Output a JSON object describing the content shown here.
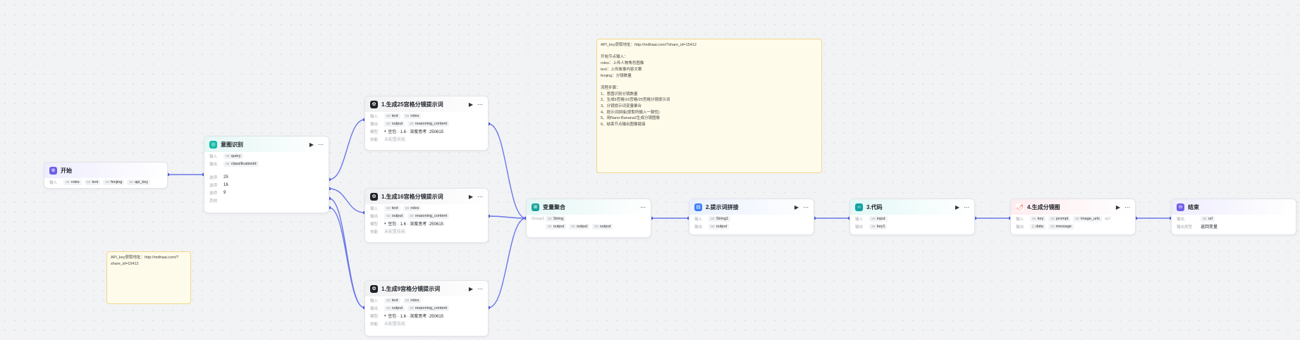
{
  "colors": {
    "wire": "#6b77e8",
    "start": "#6e5fe6",
    "intent": "#14b8a6",
    "llm": "#1f2329",
    "merge": "#14a39a",
    "prompt": "#3b7cf7",
    "code": "#12a3a3",
    "image": "#ff5a3c",
    "end": "#6e5fe6"
  },
  "labels": {
    "input": "输入",
    "output": "输出",
    "model": "模型",
    "skill": "技能",
    "option": "选项",
    "other": "其他",
    "group": "Group1",
    "output_type": "输出类型",
    "not_configured": "未配置技能"
  },
  "start": {
    "title": "开始",
    "icon": "start-icon",
    "inputs": [
      {
        "t": "Str",
        "name": "roles"
      },
      {
        "t": "Str",
        "name": "text"
      },
      {
        "t": "Str",
        "name": "fenjing"
      },
      {
        "t": "Str",
        "name": "api_key"
      }
    ]
  },
  "intent": {
    "title": "意图识别",
    "icon": "intent-icon",
    "input": {
      "t": "Str",
      "name": "query"
    },
    "output": {
      "t": "Str",
      "name": "classificationId"
    },
    "options": [
      "25",
      "16",
      "9"
    ]
  },
  "llm_nodes": [
    {
      "title": "1.生成25宫格分镜提示词",
      "inputs": [
        {
          "t": "Str",
          "name": "text"
        },
        {
          "t": "Str",
          "name": "roles"
        }
      ],
      "outputs": [
        {
          "t": "Str",
          "name": "output"
        },
        {
          "t": "Str",
          "name": "reasoning_content"
        }
      ],
      "model": "豆包 · 1.6 · 深度思考 ·250615"
    },
    {
      "title": "1.生成16宫格分镜提示词",
      "inputs": [
        {
          "t": "Str",
          "name": "text"
        },
        {
          "t": "Str",
          "name": "roles"
        }
      ],
      "outputs": [
        {
          "t": "Str",
          "name": "output"
        },
        {
          "t": "Str",
          "name": "reasoning_content"
        }
      ],
      "model": "豆包 · 1.6 · 深度思考 ·250615"
    },
    {
      "title": "1.生成9宫格分镜提示词",
      "inputs": [
        {
          "t": "Str",
          "name": "text"
        },
        {
          "t": "Str",
          "name": "roles"
        }
      ],
      "outputs": [
        {
          "t": "Str",
          "name": "output"
        },
        {
          "t": "Str",
          "name": "reasoning_content"
        }
      ],
      "model": "豆包 · 1.6 · 深度思考 ·250615"
    }
  ],
  "merge": {
    "title": "变量聚合",
    "type": "String",
    "outputs": [
      "output",
      "output",
      "output"
    ]
  },
  "prompt": {
    "title": "2.提示词拼接",
    "input": {
      "t": "Str",
      "name": "String1"
    },
    "output": {
      "t": "Str",
      "name": "output"
    }
  },
  "code": {
    "title": "3.代码",
    "input": {
      "t": "Str",
      "name": "input"
    },
    "output": {
      "t": "Str",
      "name": "key1"
    }
  },
  "image": {
    "title": "4.生成分镜图",
    "inputs": [
      {
        "t": "Str",
        "name": "key"
      },
      {
        "t": "Str",
        "name": "prompt"
      },
      {
        "t": "Str",
        "name": "image_urls"
      },
      {
        "t": "",
        "name": "api"
      }
    ],
    "outputs": [
      {
        "t": "{}",
        "name": "data"
      },
      {
        "t": "Str",
        "name": "message"
      }
    ]
  },
  "end": {
    "title": "结束",
    "output": {
      "t": "Str",
      "name": "url"
    },
    "output_type": "返回变量"
  },
  "note_large": {
    "lines": [
      "API_key获取地址：http://mdhaai.com/?share_id=15412",
      "",
      "开始节点输入：",
      "roles：上传人物角色图像",
      "text：上传故事内容文案",
      "fenjing：分镜数量",
      "",
      "流程步骤：",
      "1、意图识别分镜数量",
      "2、生成9宫格/16宫格/25宫格分镜提示词",
      "3、分镜提示词变量聚合",
      "4、提示词拼接(提取所输入一致性)",
      "5、用Nano-Banana2生成分镜图像",
      "6、结束节点输出图像链接"
    ]
  },
  "note_small": {
    "lines": [
      "API_key获取地址：http://mdhaai.com/?",
      "share_id=15412"
    ]
  }
}
